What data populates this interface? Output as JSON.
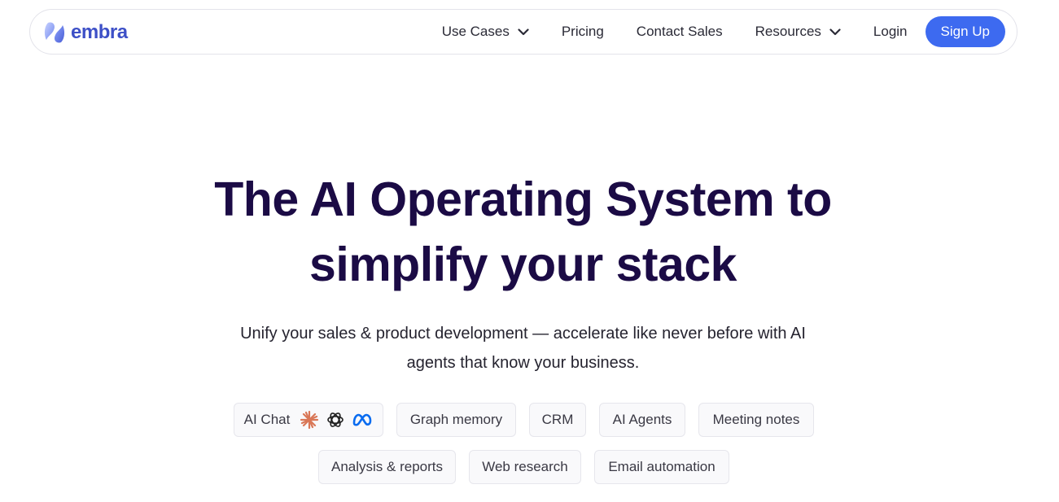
{
  "brand": {
    "name": "embra",
    "color": "#3d50c7"
  },
  "nav": {
    "items": [
      {
        "label": "Use Cases",
        "has_dropdown": true
      },
      {
        "label": "Pricing",
        "has_dropdown": false
      },
      {
        "label": "Contact Sales",
        "has_dropdown": false
      },
      {
        "label": "Resources",
        "has_dropdown": true
      },
      {
        "label": "Login",
        "has_dropdown": false
      }
    ],
    "signup_label": "Sign Up",
    "signup_color": "#3d6af0"
  },
  "hero": {
    "title_line1": "The AI Operating System to",
    "title_line2": "simplify your stack",
    "title_color": "#1b0b45",
    "subtitle_line1": "Unify your sales & product development — accelerate like never before with AI",
    "subtitle_line2": "agents that know your business."
  },
  "features": {
    "row1": [
      {
        "label": "AI Chat",
        "icons": [
          "anthropic-icon",
          "openai-icon",
          "meta-icon"
        ]
      },
      {
        "label": "Graph memory"
      },
      {
        "label": "CRM"
      },
      {
        "label": "AI Agents"
      },
      {
        "label": "Meeting notes"
      }
    ],
    "row2": [
      {
        "label": "Analysis & reports"
      },
      {
        "label": "Web research"
      },
      {
        "label": "Email automation"
      }
    ]
  }
}
